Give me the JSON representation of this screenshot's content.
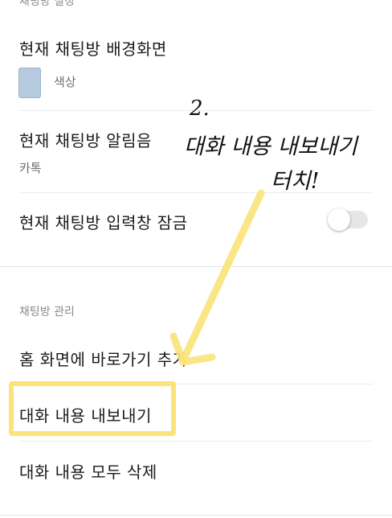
{
  "top_section": {
    "header": "채팅방 설정",
    "background": {
      "title": "현재 채팅방 배경화면",
      "color_label": "색상",
      "swatch_color": "#b7cbe0"
    },
    "notification": {
      "title": "현재 채팅방 알림음",
      "value": "카톡"
    },
    "input_lock": {
      "title": "현재 채팅방 입력창 잠금",
      "toggle_on": false
    }
  },
  "management_section": {
    "header": "채팅방 관리",
    "items": [
      {
        "label": "홈 화면에 바로가기 추가"
      },
      {
        "label": "대화 내용 내보내기"
      },
      {
        "label": "대화 내용 모두 삭제"
      }
    ]
  },
  "annotation": {
    "step_number": "2.",
    "line1": "대화 내용 내보내기",
    "line2": "터치!",
    "highlight_color": "#fbe37a"
  }
}
